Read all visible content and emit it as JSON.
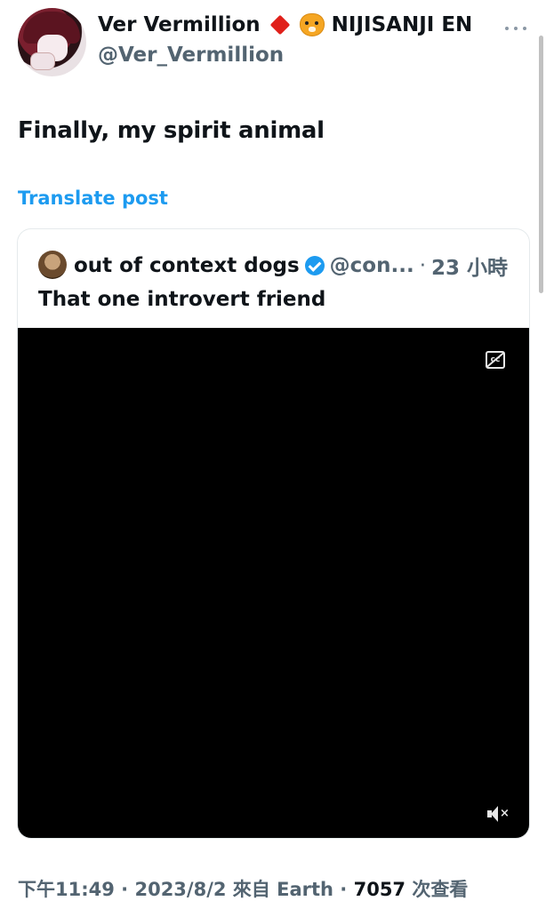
{
  "post": {
    "author_name": "Ver Vermillion",
    "author_suffix": "NIJISANJI EN",
    "author_handle": "@Ver_Vermillion",
    "text": "Finally, my spirit animal",
    "translate_label": "Translate post"
  },
  "quoted": {
    "name": "out of context dogs",
    "handle": "@con...",
    "separator": "·",
    "time": "23 小時",
    "text": "That one introvert friend"
  },
  "meta": {
    "time": "下午11:49",
    "sep1": " · ",
    "date": "2023/8/2",
    "from": " 來自 ",
    "source": "Earth",
    "sep2": " · ",
    "views": "7057",
    "views_label": " 次查看"
  },
  "colors": {
    "accent": "#1d9bf0",
    "muted": "#536471",
    "text": "#0f1419"
  },
  "icons": [
    "diamond-icon",
    "tiger-icon",
    "more-icon",
    "verified-icon",
    "cc-icon",
    "mute-icon"
  ]
}
